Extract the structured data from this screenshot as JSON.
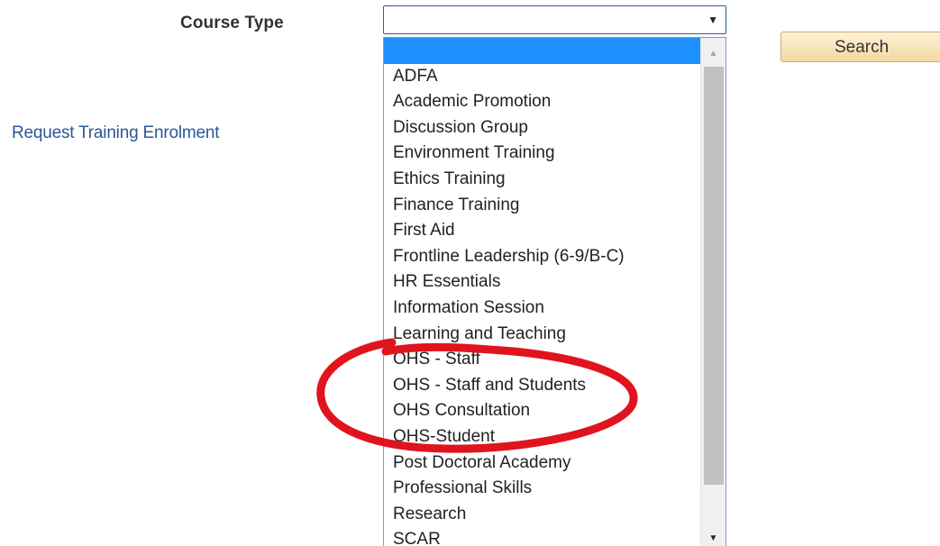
{
  "form": {
    "course_type_label": "Course Type",
    "course_type_value": "",
    "search_label": "Search",
    "request_link": "Request Training Enrolment"
  },
  "dropdown": {
    "options": [
      "",
      "ADFA",
      "Academic Promotion",
      "Discussion Group",
      "Environment Training",
      "Ethics Training",
      "Finance Training",
      "First Aid",
      "Frontline Leadership (6-9/B-C)",
      "HR Essentials",
      "Information Session",
      "Learning and Teaching",
      "OHS - Staff",
      "OHS - Staff and Students",
      "OHS Consultation",
      "OHS-Student",
      "Post Doctoral Academy",
      "Professional Skills",
      "Research",
      "SCAR"
    ],
    "selected_index": 0
  },
  "icons": {
    "select_arrow": "dropdown-arrow-icon",
    "scroll_up": "scroll-up-arrow-icon",
    "scroll_down": "scroll-down-arrow-icon"
  },
  "annotation": {
    "color": "#e0141e",
    "marks": "red ellipse around OHS options"
  },
  "colors": {
    "selection": "#1e90ff",
    "link": "#2b5797",
    "button": "#f3d9a2"
  }
}
